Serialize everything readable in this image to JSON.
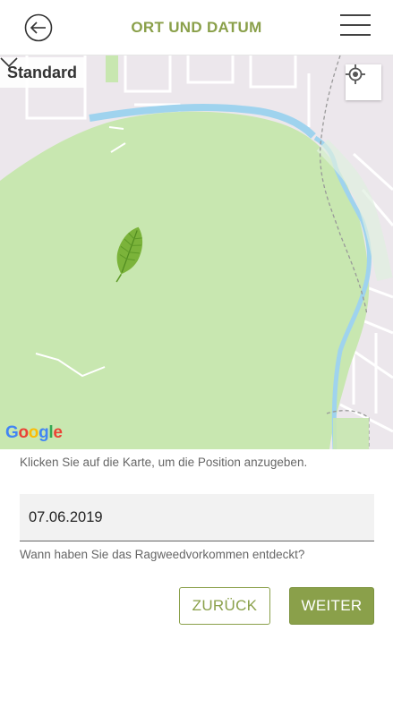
{
  "header": {
    "title": "ORT UND DATUM",
    "back_icon": "arrow-left-circle-icon",
    "menu_icon": "hamburger-menu-icon"
  },
  "map": {
    "type_selector_label": "Standard",
    "type_selector_icon": "chevron-down-icon",
    "locate_icon": "crosshair-location-icon",
    "marker_icon": "ragweed-leaf-icon",
    "provider_logo": "Google",
    "colors": {
      "park": "#c8e7b0",
      "urban": "#ece7ec",
      "water": "#9fd3ee",
      "accent": "#8aa04a"
    }
  },
  "form": {
    "map_hint": "Klicken Sie auf die Karte, um die Position anzugeben.",
    "date_value": "07.06.2019",
    "date_helper": "Wann haben Sie das Ragweedvorkommen entdeckt?"
  },
  "buttons": {
    "back_label": "ZURÜCK",
    "next_label": "WEITER"
  }
}
